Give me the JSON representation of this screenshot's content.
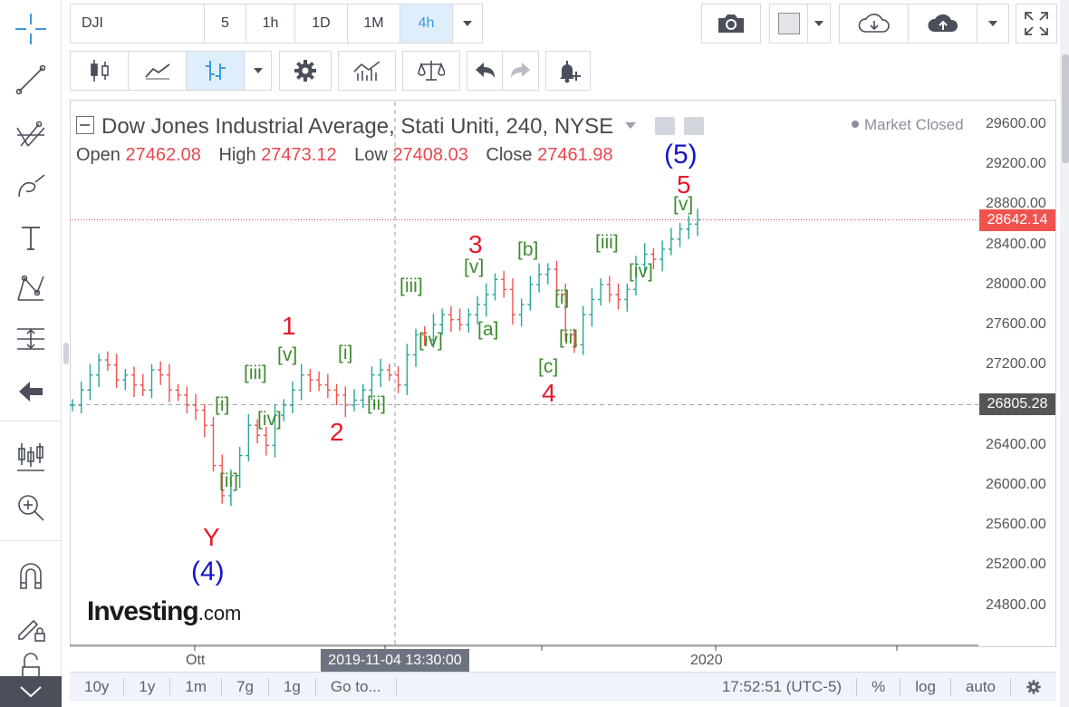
{
  "toolbar": {
    "symbol": "DJI",
    "intervals": [
      "5",
      "1h",
      "1D",
      "1M",
      "4h"
    ],
    "active_interval": "4h"
  },
  "chart": {
    "title": "Dow Jones Industrial Average, Stati Uniti, 240, NYSE",
    "open_label": "Open",
    "open_value": "27462.08",
    "high_label": "High",
    "high_value": "27473.12",
    "low_label": "Low",
    "low_value": "27408.03",
    "close_label": "Close",
    "close_value": "27461.98",
    "market_status": "Market Closed",
    "current_price": "28642.14",
    "crosshair_price": "26805.28",
    "crosshair_time": "2019-11-04 13:30:00",
    "price_ticks": [
      "29600.00",
      "29200.00",
      "28800.00",
      "28400.00",
      "28000.00",
      "27600.00",
      "27200.00",
      "26400.00",
      "26000.00",
      "25600.00",
      "25200.00",
      "24800.00"
    ],
    "time_ticks": [
      "Ott",
      "2020"
    ],
    "logo_main": "Investing",
    "logo_suffix": ".com",
    "colors": {
      "up": "#26a69a",
      "down": "#ef5350",
      "price_badge": "#ef5350",
      "crosshair_badge": "#555555"
    }
  },
  "waves": {
    "major": [
      "1",
      "2",
      "3",
      "4",
      "5",
      "Y"
    ],
    "degree": [
      "(4)",
      "(5)"
    ],
    "minor": [
      "[i]",
      "[ii]",
      "[iii]",
      "[iv]",
      "[v]",
      "[i]",
      "[ii]",
      "[iii]",
      "[v]",
      "[iv]",
      "[a]",
      "[b]",
      "[c]",
      "[i]",
      "[ii]",
      "[iii]",
      "[iv]",
      "[v]"
    ]
  },
  "bottom": {
    "ranges": [
      "10y",
      "1y",
      "1m",
      "7g",
      "1g"
    ],
    "goto": "Go to...",
    "clock": "17:52:51 (UTC-5)",
    "percent": "%",
    "log": "log",
    "auto": "auto"
  },
  "chart_data": {
    "type": "candlestick",
    "title": "Dow Jones Industrial Average, Stati Uniti, 240, NYSE",
    "xlabel": "",
    "ylabel": "",
    "ylim": [
      24600,
      29800
    ],
    "x_ticks": [
      "Ott",
      "2020"
    ],
    "y_ticks": [
      24800,
      25200,
      25600,
      26000,
      26400,
      26800,
      27200,
      27600,
      28000,
      28400,
      28800,
      29200,
      29600
    ],
    "last_price": 28642.14,
    "crosshair_price": 26805.28,
    "closes": [
      26800,
      26950,
      27100,
      27250,
      27200,
      27050,
      27100,
      27000,
      26950,
      27150,
      27100,
      26950,
      26900,
      26800,
      26750,
      26600,
      26200,
      25900,
      26100,
      26300,
      26600,
      26500,
      26400,
      26700,
      26800,
      26950,
      27100,
      27050,
      27000,
      26950,
      26900,
      26800,
      26850,
      26950,
      27100,
      27150,
      27100,
      27000,
      27300,
      27500,
      27450,
      27600,
      27700,
      27650,
      27600,
      27700,
      27800,
      27900,
      28050,
      27950,
      27700,
      27800,
      28000,
      28100,
      28150,
      27900,
      27500,
      27400,
      27700,
      27850,
      28000,
      27900,
      27850,
      27950,
      28200,
      28300,
      28250,
      28350,
      28450,
      28550,
      28600,
      28642
    ]
  }
}
